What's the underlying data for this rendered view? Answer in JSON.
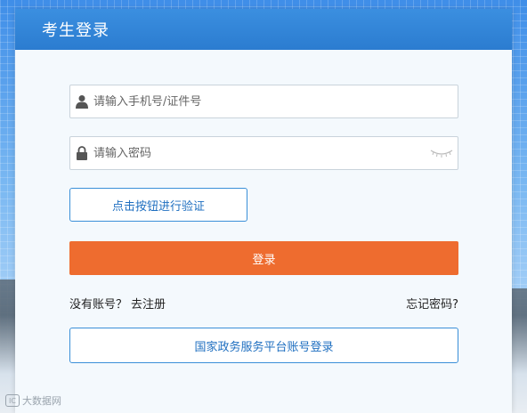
{
  "header": {
    "title": "考生登录"
  },
  "form": {
    "account_placeholder": "请输入手机号/证件号",
    "password_placeholder": "请输入密码",
    "verify_label": "点击按钮进行验证",
    "login_label": "登录"
  },
  "links": {
    "no_account": "没有账号？",
    "register": "去注册",
    "forgot": "忘记密码?"
  },
  "gov_login_label": "国家政务服务平台账号登录",
  "watermark": {
    "logo": "IC",
    "text": "大数据网"
  },
  "colors": {
    "header": "#2f83d6",
    "accent": "#ee6c2f",
    "link_blue": "#1f6fc0"
  },
  "icons": [
    "user-icon",
    "lock-icon",
    "eye-closed-icon"
  ]
}
